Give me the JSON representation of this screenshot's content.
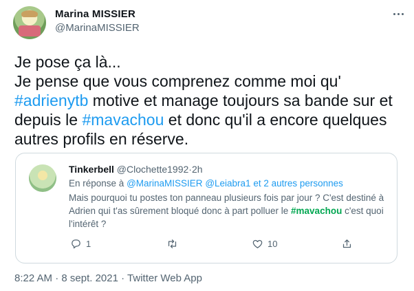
{
  "author": {
    "name": "Marina MISSIER",
    "handle": "@MarinaMISSIER"
  },
  "tweet": {
    "line1": "Je pose ça là...",
    "line2a": "Je pense que vous comprenez comme moi qu'",
    "hashtag1": "#adrienytb",
    "line3a": " motive et manage toujours sa bande sur et",
    "line4a": "depuis le ",
    "hashtag2": "#mavachou",
    "line4b": " et donc qu'il a encore quelques",
    "line5": "autres profils en réserve."
  },
  "quote": {
    "name": "Tinkerbell",
    "handle": "@Clochette1992",
    "separator": "·",
    "time": "2h",
    "reply_prefix": "En réponse à ",
    "reply_mention1": "@MarinaMISSIER",
    "reply_mention2": "@Leiabra1",
    "reply_others": "et 2 autres personnes",
    "body_part1": "Mais pourquoi tu postes ton panneau plusieurs fois par jour ? C'est destiné à Adrien qui t'as sûrement bloqué donc à part polluer le ",
    "body_tag": "#mavachou",
    "body_part2": " c'est quoi l'intérêt ?",
    "reply_count": "1",
    "retweet_count": "",
    "like_count": "10"
  },
  "meta": {
    "time": "8:22 AM",
    "separator1": "·",
    "date": "8 sept. 2021",
    "separator2": "·",
    "source": "Twitter Web App"
  },
  "colors": {
    "link": "#1d9bf0",
    "hashtag_quote": "#00a650",
    "secondary_text": "#536471",
    "border": "#cfd9de"
  },
  "icons": {
    "avatar": "profile-avatar",
    "more": "more-icon",
    "reply": "reply-icon",
    "retweet": "retweet-icon",
    "like": "heart-icon",
    "share": "share-icon"
  }
}
